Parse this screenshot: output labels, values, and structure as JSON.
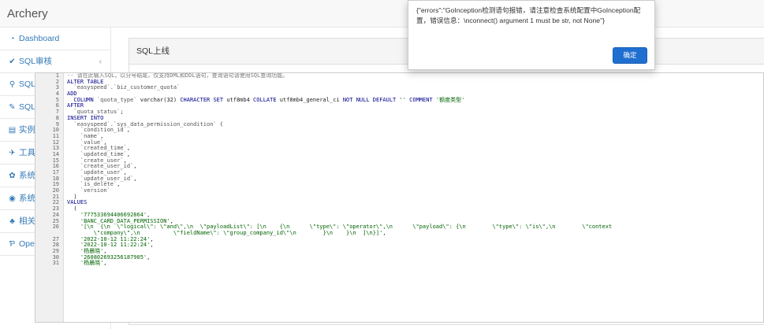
{
  "app": {
    "brand": "Archery"
  },
  "sidebar": {
    "items": [
      {
        "label": "Dashboard",
        "icon": "dashboard-icon",
        "glyph": "◔",
        "caret": ""
      },
      {
        "label": "SQL审核",
        "icon": "check-icon",
        "glyph": "✔",
        "caret": "‹"
      },
      {
        "label": "SQL查询",
        "icon": "search-icon",
        "glyph": "⚲",
        "caret": "‹"
      },
      {
        "label": "SQL优化",
        "icon": "wrench-icon",
        "glyph": "✎",
        "caret": "‹"
      },
      {
        "label": "实例管理",
        "icon": "database-icon",
        "glyph": "▤",
        "caret": "‹"
      },
      {
        "label": "工具插件",
        "icon": "rocket-icon",
        "glyph": "✈",
        "caret": "‹"
      },
      {
        "label": "系统管理",
        "icon": "cogs-icon",
        "glyph": "✿",
        "caret": "‹"
      },
      {
        "label": "系统审计",
        "icon": "eye-icon",
        "glyph": "◉",
        "caret": "‹"
      },
      {
        "label": "相关文档",
        "icon": "sitemap-icon",
        "glyph": "♣",
        "caret": ""
      },
      {
        "label": "OpenAPI",
        "icon": "api-icon",
        "glyph": "Ƥ",
        "caret": ""
      }
    ]
  },
  "panel": {
    "title": "SQL上线"
  },
  "editor": {
    "lines": [
      {
        "n": "1",
        "segs": [
          {
            "c": "cm",
            "t": "-- 请在此输入SQL，以分号结尾，仅支持DML和DDL语句，查询语句请使用SQL查询功能。"
          }
        ]
      },
      {
        "n": "2",
        "segs": [
          {
            "c": "kw",
            "t": "ALTER TABLE"
          }
        ]
      },
      {
        "n": "3",
        "segs": [
          {
            "c": "ident",
            "t": "  `easyspeed`.`biz_customer_quota`"
          }
        ]
      },
      {
        "n": "4",
        "segs": [
          {
            "c": "kw",
            "t": "ADD"
          }
        ]
      },
      {
        "n": "5",
        "segs": [
          {
            "c": "kw",
            "t": "  COLUMN "
          },
          {
            "c": "ident",
            "t": "`quota_type` "
          },
          {
            "c": "plain",
            "t": "varchar(32) "
          },
          {
            "c": "kw",
            "t": "CHARACTER SET "
          },
          {
            "c": "plain",
            "t": "utf8mb4 "
          },
          {
            "c": "kw",
            "t": "COLLATE "
          },
          {
            "c": "plain",
            "t": "utf8mb4_general_ci "
          },
          {
            "c": "kw",
            "t": "NOT NULL DEFAULT "
          },
          {
            "c": "str",
            "t": "'' "
          },
          {
            "c": "kw",
            "t": "COMMENT "
          },
          {
            "c": "str",
            "t": "'额度类型'"
          }
        ]
      },
      {
        "n": "6",
        "segs": [
          {
            "c": "kw",
            "t": "AFTER"
          }
        ]
      },
      {
        "n": "7",
        "segs": [
          {
            "c": "ident",
            "t": "  `quota_status`"
          },
          {
            "c": "plain",
            "t": ";"
          }
        ]
      },
      {
        "n": "8",
        "segs": [
          {
            "c": "kw",
            "t": "INSERT INTO"
          }
        ]
      },
      {
        "n": "9",
        "segs": [
          {
            "c": "ident",
            "t": "  `easyspeed`.`sys_data_permission_condition` "
          },
          {
            "c": "plain",
            "t": "("
          }
        ]
      },
      {
        "n": "10",
        "segs": [
          {
            "c": "ident",
            "t": "    `condition_id`"
          },
          {
            "c": "plain",
            "t": ","
          }
        ]
      },
      {
        "n": "11",
        "segs": [
          {
            "c": "ident",
            "t": "    `name`"
          },
          {
            "c": "plain",
            "t": ","
          }
        ]
      },
      {
        "n": "12",
        "segs": [
          {
            "c": "ident",
            "t": "    `value`"
          },
          {
            "c": "plain",
            "t": ","
          }
        ]
      },
      {
        "n": "13",
        "segs": [
          {
            "c": "ident",
            "t": "    `created_time`"
          },
          {
            "c": "plain",
            "t": ","
          }
        ]
      },
      {
        "n": "14",
        "segs": [
          {
            "c": "ident",
            "t": "    `updated_time`"
          },
          {
            "c": "plain",
            "t": ","
          }
        ]
      },
      {
        "n": "15",
        "segs": [
          {
            "c": "ident",
            "t": "    `create_user`"
          },
          {
            "c": "plain",
            "t": ","
          }
        ]
      },
      {
        "n": "16",
        "segs": [
          {
            "c": "ident",
            "t": "    `create_user_id`"
          },
          {
            "c": "plain",
            "t": ","
          }
        ]
      },
      {
        "n": "17",
        "segs": [
          {
            "c": "ident",
            "t": "    `update_user`"
          },
          {
            "c": "plain",
            "t": ","
          }
        ]
      },
      {
        "n": "18",
        "segs": [
          {
            "c": "ident",
            "t": "    `update_user_id`"
          },
          {
            "c": "plain",
            "t": ","
          }
        ]
      },
      {
        "n": "19",
        "segs": [
          {
            "c": "ident",
            "t": "    `is_delete`"
          },
          {
            "c": "plain",
            "t": ","
          }
        ]
      },
      {
        "n": "20",
        "segs": [
          {
            "c": "ident",
            "t": "    `version`"
          }
        ]
      },
      {
        "n": "21",
        "segs": [
          {
            "c": "plain",
            "t": "  )"
          }
        ]
      },
      {
        "n": "22",
        "segs": [
          {
            "c": "kw",
            "t": "VALUES"
          }
        ]
      },
      {
        "n": "23",
        "segs": [
          {
            "c": "plain",
            "t": "  ("
          }
        ]
      },
      {
        "n": "24",
        "segs": [
          {
            "c": "str",
            "t": "    '777533694406692864'"
          },
          {
            "c": "plain",
            "t": ","
          }
        ]
      },
      {
        "n": "25",
        "segs": [
          {
            "c": "str",
            "t": "    'BANC_CARD_DATA_PERMISSION'"
          },
          {
            "c": "plain",
            "t": ","
          }
        ]
      },
      {
        "n": "26",
        "segs": [
          {
            "c": "str",
            "t": "    '[\\n  {\\n  \\\"logical\\\": \\\"and\\\",\\n  \\\"payloadList\\\": [\\n    {\\n      \\\"type\\\": \\\"operator\\\",\\n      \\\"payload\\\": {\\n        \\\"type\\\": \\\"is\\\",\\n        \\\"context"
          }
        ]
      },
      {
        "n": "",
        "segs": [
          {
            "c": "str",
            "t": "        \\\"company\\\",\\n          \\\"fieldName\\\": \\\"group_company_id\\\"\\n        }\\n    }\\n  ]\\n}]'"
          },
          {
            "c": "plain",
            "t": ","
          }
        ]
      },
      {
        "n": "27",
        "segs": [
          {
            "c": "str",
            "t": "    '2022-10-12 11:22:24'"
          },
          {
            "c": "plain",
            "t": ","
          }
        ]
      },
      {
        "n": "28",
        "segs": [
          {
            "c": "str",
            "t": "    '2022-10-12 11:22:24'"
          },
          {
            "c": "plain",
            "t": ","
          }
        ]
      },
      {
        "n": "29",
        "segs": [
          {
            "c": "str",
            "t": "    '杨晨晓'"
          },
          {
            "c": "plain",
            "t": ","
          }
        ]
      },
      {
        "n": "30",
        "segs": [
          {
            "c": "str",
            "t": "    '260802693256187905'"
          },
          {
            "c": "plain",
            "t": ","
          }
        ]
      },
      {
        "n": "31",
        "segs": [
          {
            "c": "str",
            "t": "    '杨晨晓'"
          },
          {
            "c": "plain",
            "t": ","
          }
        ]
      }
    ]
  },
  "popup": {
    "message": "{\"errors\":\"GoInception检测语句报错，请注意检查系统配置中GoInception配置，错误信息：\\nconnect() argument 1 must be str, not None\"}",
    "confirm_label": "确定"
  },
  "colors": {
    "primary": "#1f6fd0",
    "link": "#337ab7",
    "keyword": "#00008b",
    "string": "#006400"
  }
}
